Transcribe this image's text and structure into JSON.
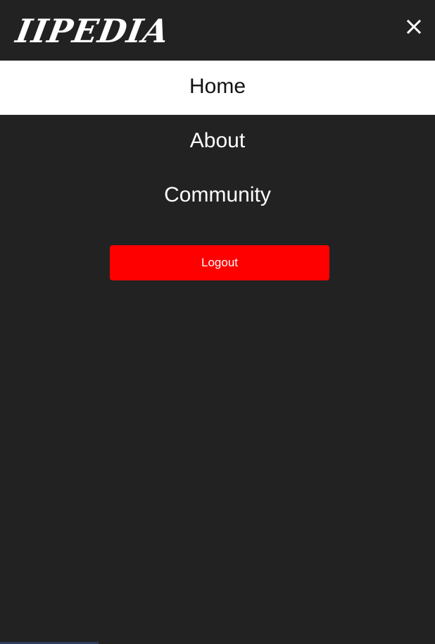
{
  "header": {
    "logo_text": "IIPEDIA",
    "close_icon": "close-icon"
  },
  "nav": {
    "items": [
      {
        "label": "Home",
        "active": true
      },
      {
        "label": "About",
        "active": false
      },
      {
        "label": "Community",
        "active": false
      }
    ]
  },
  "actions": {
    "logout_label": "Logout"
  },
  "colors": {
    "background": "#222222",
    "active_item_bg": "#ffffff",
    "logout_bg": "#ff0000",
    "text_light": "#ffffff"
  }
}
